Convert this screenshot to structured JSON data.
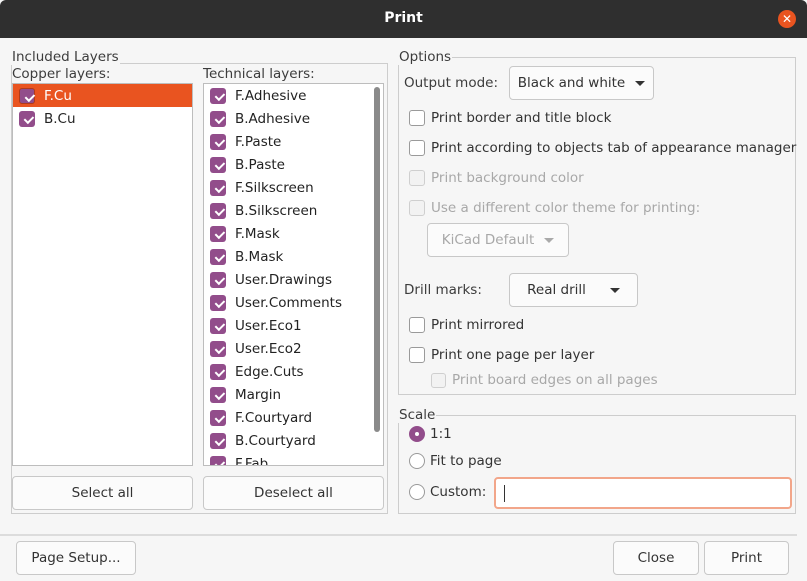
{
  "window": {
    "title": "Print",
    "close_icon": "close-icon"
  },
  "colors": {
    "accent": "#e95420",
    "checkbox": "#924d8b"
  },
  "layers": {
    "group_label": "Included Layers",
    "copper_label": "Copper layers:",
    "technical_label": "Technical layers:",
    "copper": [
      {
        "label": "F.Cu",
        "checked": true,
        "selected": true
      },
      {
        "label": "B.Cu",
        "checked": true
      }
    ],
    "technical": [
      "F.Adhesive",
      "B.Adhesive",
      "F.Paste",
      "B.Paste",
      "F.Silkscreen",
      "B.Silkscreen",
      "F.Mask",
      "B.Mask",
      "User.Drawings",
      "User.Comments",
      "User.Eco1",
      "User.Eco2",
      "Edge.Cuts",
      "Margin",
      "F.Courtyard",
      "B.Courtyard",
      "F.Fab"
    ],
    "select_all": "Select all",
    "deselect_all": "Deselect all"
  },
  "options": {
    "group_label": "Options",
    "output_mode_label": "Output mode:",
    "output_mode_value": "Black and white",
    "print_border": "Print border and title block",
    "print_according": "Print according to objects tab of appearance manager",
    "print_background": "Print background color",
    "different_theme": "Use a different color theme for printing:",
    "theme_value": "KiCad Default",
    "drill_marks_label": "Drill marks:",
    "drill_marks_value": "Real drill",
    "print_mirrored": "Print mirrored",
    "one_page_per_layer": "Print one page per layer",
    "board_edges": "Print board edges on all pages"
  },
  "scale": {
    "group_label": "Scale",
    "one_to_one": "1:1",
    "fit_to_page": "Fit to page",
    "custom": "Custom:",
    "custom_value": "",
    "selected": "1:1"
  },
  "footer": {
    "page_setup": "Page Setup...",
    "close": "Close",
    "print": "Print"
  }
}
